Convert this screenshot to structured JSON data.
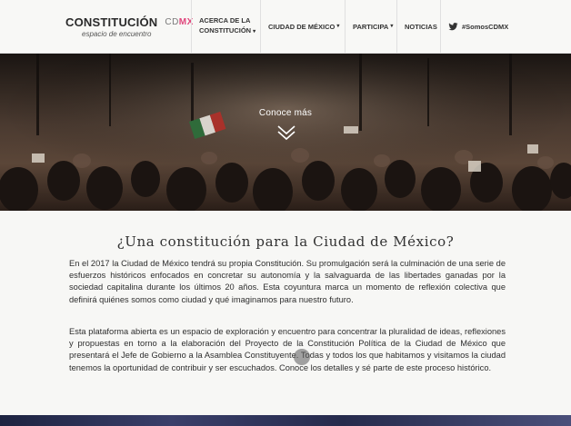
{
  "nav": {
    "brand_name": "CONSTITUCIÓN",
    "brand_cd": "CD",
    "brand_mx": "MX",
    "brand_tagline": "espacio de encuentro",
    "items": [
      {
        "label_line1": "ACERCA DE LA",
        "label_line2": "CONSTITUCIÓN",
        "dropdown": true
      },
      {
        "label": "CIUDAD DE MÉXICO",
        "dropdown": true
      },
      {
        "label": "PARTICIPA",
        "dropdown": true
      },
      {
        "label": "NOTICIAS",
        "dropdown": false
      },
      {
        "label": "#SomosCDMX",
        "icon": "twitter-icon"
      }
    ],
    "accent_color": "#e0457b"
  },
  "hero": {
    "cta": "Conoce más",
    "icon": "chevron-down-icon"
  },
  "main": {
    "title": "¿Una constitución para la Ciudad de México?",
    "paragraph1": "En el 2017 la Ciudad de México tendrá su propia Constitución. Su promulgación será la culminación de una serie de esfuerzos históricos enfocados en concretar su autonomía y la salvaguarda de las libertades ganadas por la sociedad capitalina durante los últimos 20 años. Esta coyuntura marca un momento de reflexión colectiva que definirá quiénes somos como ciudad y qué imaginamos para nuestro futuro.",
    "paragraph2": "Esta plataforma abierta es un espacio de exploración y encuentro para concentrar la pluralidad de ideas, reflexiones y propuestas en torno a la elaboración del Proyecto de la Constitución Política de la Ciudad de México que presentará el Jefe de Gobierno a la Asamblea Constituyente. Todas y todos los que habitamos y visitamos la ciudad tenemos la oportunidad de contribuir y ser escuchados. Conoce los detalles y sé parte de este proceso histórico."
  }
}
